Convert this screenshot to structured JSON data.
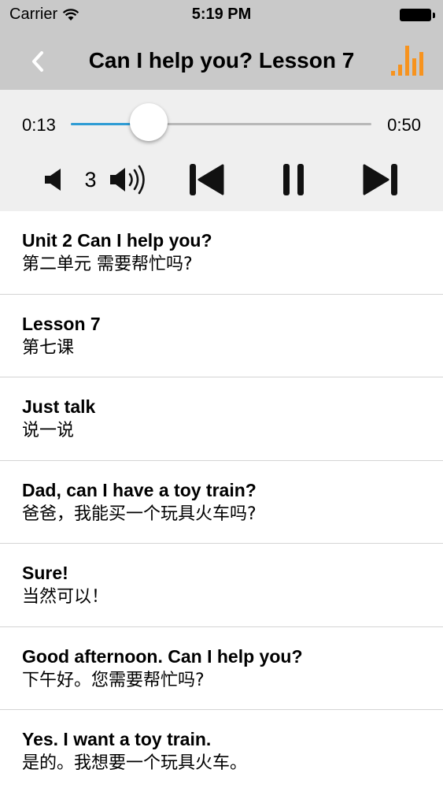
{
  "status_bar": {
    "carrier": "Carrier",
    "time": "5:19 PM"
  },
  "nav": {
    "title": "Can I help you? Lesson 7",
    "back_icon": "chevron-left-icon",
    "stats_icon": "bar-chart-icon",
    "accent_color": "#f7931e"
  },
  "player": {
    "current_time": "0:13",
    "duration": "0:50",
    "progress": 0.26,
    "volume_level": "3",
    "progress_color": "#2e9cd4"
  },
  "lines": [
    {
      "en": "Unit 2 Can I help you?",
      "zh": "第二单元 需要帮忙吗?"
    },
    {
      "en": "Lesson 7",
      "zh": "第七课"
    },
    {
      "en": "Just talk",
      "zh": "说一说"
    },
    {
      "en": "Dad, can I have a toy train?",
      "zh": "爸爸，我能买一个玩具火车吗?"
    },
    {
      "en": "Sure!",
      "zh": "当然可以！"
    },
    {
      "en": "Good afternoon. Can I help you?",
      "zh": "下午好。您需要帮忙吗?"
    },
    {
      "en": "Yes. I want a toy train.",
      "zh": "是的。我想要一个玩具火车。"
    }
  ],
  "selected_line": 3
}
